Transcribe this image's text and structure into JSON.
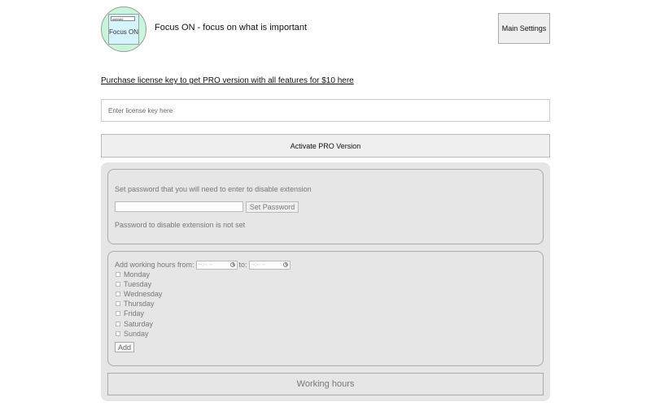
{
  "app": {
    "logo_tag": "website",
    "logo_text": "Focus ON",
    "title": "Focus ON - focus on what is important",
    "main_settings_label": "Main Settings"
  },
  "license": {
    "purchase_link": "Purchase license key to get PRO version with all features for $10 here",
    "input_placeholder": "Enter license key here",
    "input_value": "",
    "activate_label": "Activate PRO Version"
  },
  "password": {
    "label": "Set password that you will need to enter to disable extension",
    "input_value": "",
    "set_button": "Set Password",
    "status": "Password to disable extension is not set"
  },
  "working_hours": {
    "from_label": "Add working hours from:",
    "to_label": "to:",
    "time_placeholder": "--:-- --",
    "days": [
      {
        "label": "Monday",
        "checked": false
      },
      {
        "label": "Tuesday",
        "checked": false
      },
      {
        "label": "Wednesday",
        "checked": false
      },
      {
        "label": "Thursday",
        "checked": false
      },
      {
        "label": "Friday",
        "checked": false
      },
      {
        "label": "Saturday",
        "checked": false
      },
      {
        "label": "Sunday",
        "checked": false
      }
    ],
    "add_button": "Add",
    "section_title": "Working hours"
  },
  "icons": [
    "clock-icon"
  ]
}
